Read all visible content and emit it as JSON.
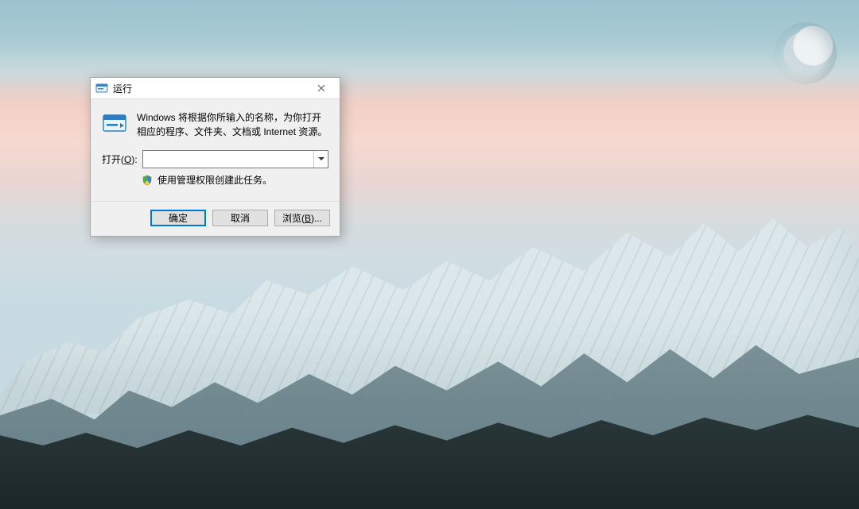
{
  "dialog": {
    "title": "运行",
    "description": "Windows 将根据你所输入的名称，为你打开相应的程序、文件夹、文档或 Internet 资源。",
    "open_label_prefix": "打开(",
    "open_label_accel": "O",
    "open_label_suffix": "):",
    "open_value": "",
    "admin_note": "使用管理权限创建此任务。",
    "buttons": {
      "ok": "确定",
      "cancel": "取消",
      "browse_prefix": "浏览(",
      "browse_accel": "B",
      "browse_suffix": ")..."
    }
  },
  "icons": {
    "title_icon": "run-icon",
    "body_icon": "run-icon-large",
    "shield_icon": "shield-icon",
    "close_icon": "close-icon",
    "dropdown_icon": "chevron-down-icon"
  }
}
